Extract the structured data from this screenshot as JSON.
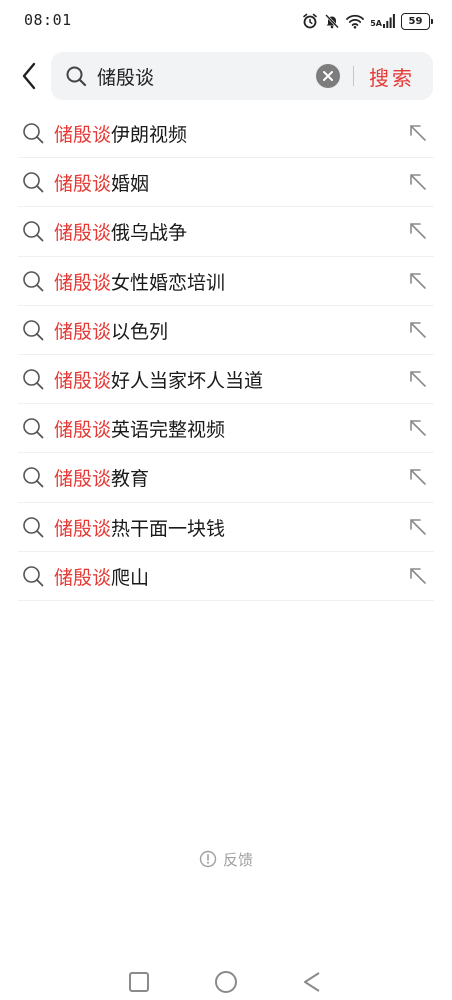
{
  "status": {
    "time": "08:01",
    "network": "5A",
    "battery": "59",
    "icons": [
      "alarm-icon",
      "mute-icon",
      "wifi-icon",
      "cellular-signal-icon",
      "battery-icon"
    ]
  },
  "search": {
    "value": "储殷谈",
    "submit_label": "搜索",
    "icons": [
      "back-arrow-icon",
      "search-icon",
      "clear-icon"
    ]
  },
  "suggestions": [
    {
      "highlight": "储殷谈",
      "rest": "伊朗视频"
    },
    {
      "highlight": "储殷谈",
      "rest": "婚姻"
    },
    {
      "highlight": "储殷谈",
      "rest": "俄乌战争"
    },
    {
      "highlight": "储殷谈",
      "rest": "女性婚恋培训"
    },
    {
      "highlight": "储殷谈",
      "rest": "以色列"
    },
    {
      "highlight": "储殷谈",
      "rest": "好人当家坏人当道"
    },
    {
      "highlight": "储殷谈",
      "rest": "英语完整视频"
    },
    {
      "highlight": "储殷谈",
      "rest": "教育"
    },
    {
      "highlight": "储殷谈",
      "rest": "热干面一块钱"
    },
    {
      "highlight": "储殷谈",
      "rest": "爬山"
    }
  ],
  "feedback": {
    "label": "反馈",
    "icon": "info-icon"
  },
  "nav": {
    "icons": [
      "recents-icon",
      "home-icon",
      "back-icon"
    ]
  },
  "colors": {
    "accent": "#e53935",
    "search_bg": "#f2f3f5",
    "muted": "#a0a0a0"
  }
}
